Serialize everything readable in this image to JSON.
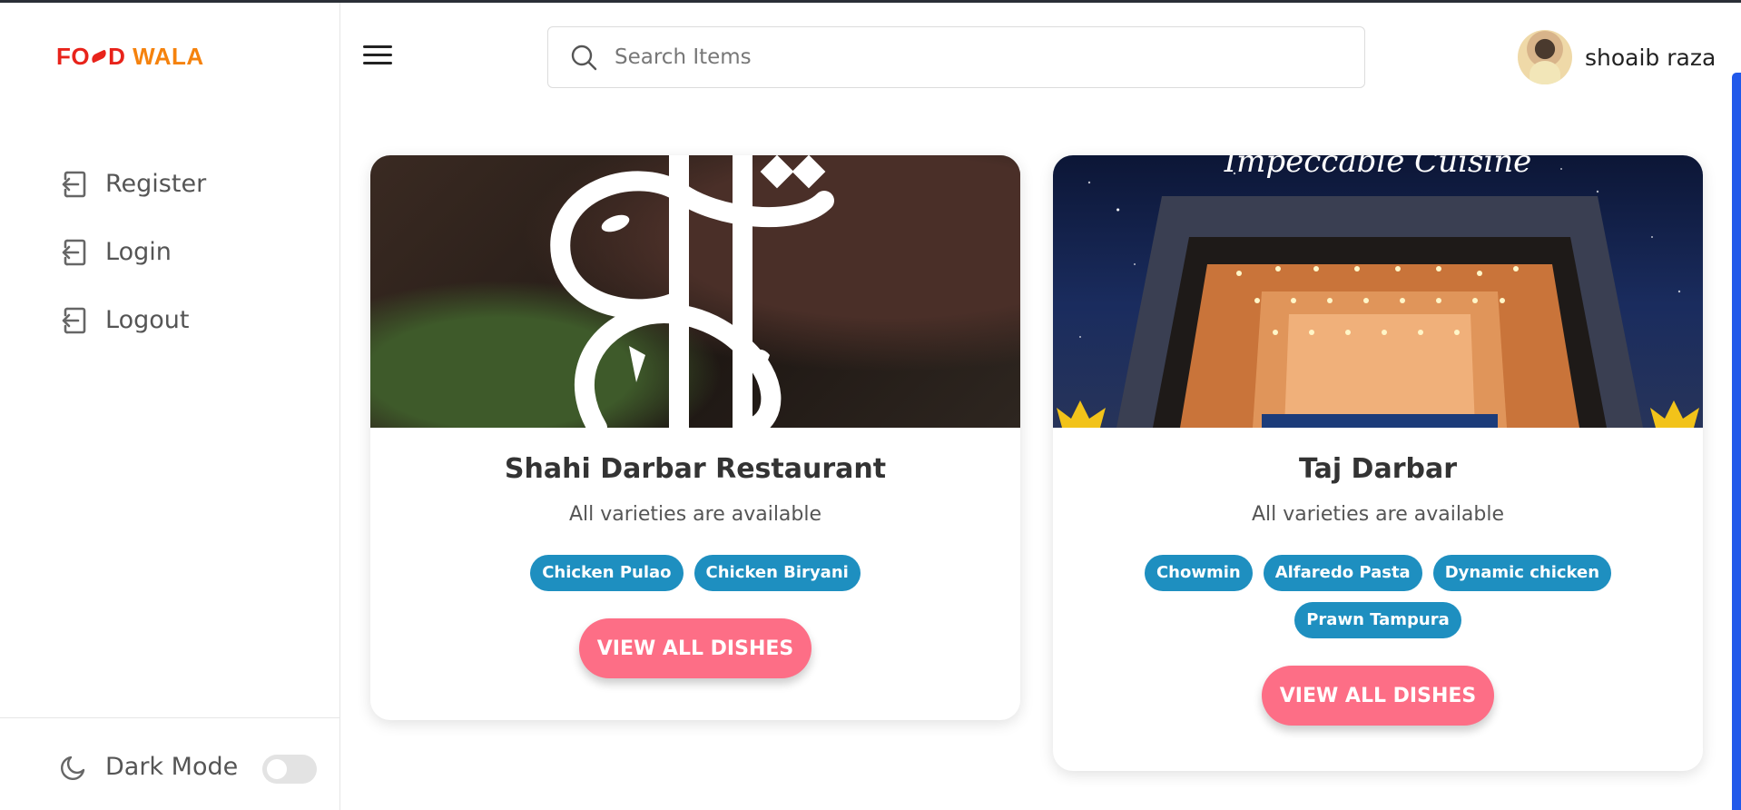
{
  "brand": {
    "logo_part1": "FO",
    "logo_part2": "D",
    "logo_part3": "WALA"
  },
  "sidebar": {
    "items": [
      {
        "label": "Register",
        "icon": "login-icon"
      },
      {
        "label": "Login",
        "icon": "login-icon"
      },
      {
        "label": "Logout",
        "icon": "login-icon"
      }
    ],
    "dark_mode_label": "Dark Mode",
    "dark_mode_on": false
  },
  "header": {
    "search_placeholder": "Search Items",
    "username": "shoaib raza"
  },
  "restaurants": [
    {
      "name": "Shahi Darbar Restaurant",
      "subtitle": "All varieties are available",
      "tags": [
        "Chicken Pulao",
        "Chicken Biryani"
      ],
      "button": "VIEW ALL DISHES"
    },
    {
      "name": "Taj Darbar",
      "subtitle": "All varieties are available",
      "tags": [
        "Chowmin",
        "Alfaredo Pasta",
        "Dynamic chicken",
        "Prawn Tampura"
      ],
      "button": "VIEW ALL DISHES",
      "image_text": "Impeccable Cuisine"
    }
  ],
  "colors": {
    "tag": "#1e8fc0",
    "button": "#fd6e86",
    "logo_red": "#e8231b",
    "logo_orange": "#f5820d"
  }
}
